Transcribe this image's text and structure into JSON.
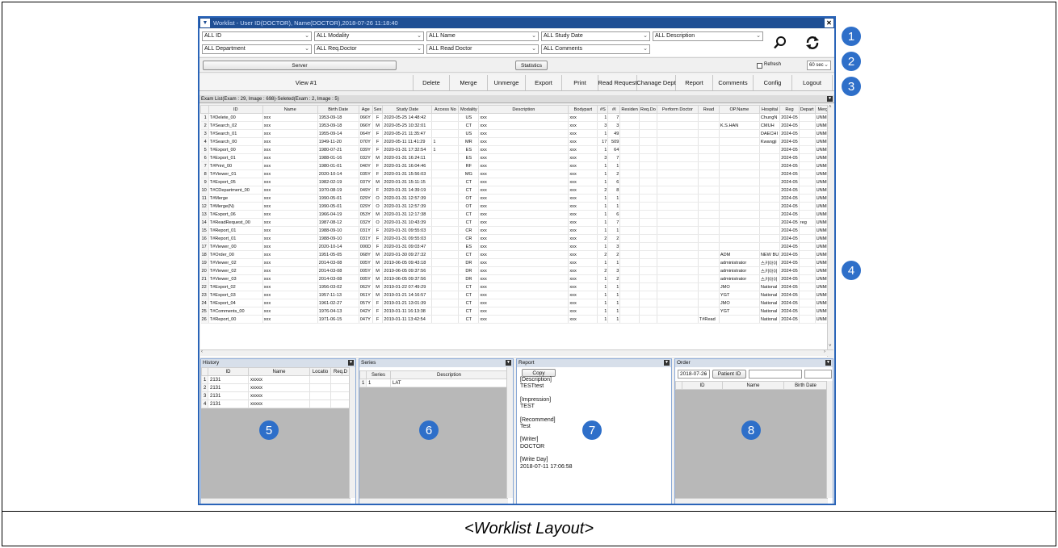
{
  "window": {
    "title": "Worklist - User ID(DOCTOR), Name(DOCTOR),2018-07-26 11:18:40"
  },
  "filters": {
    "row1": [
      "ALL ID",
      "ALL Modality",
      "ALL Name",
      "ALL Study Date",
      "ALL Description"
    ],
    "row2": [
      "ALL Department",
      "ALL Req.Doctor",
      "ALL Read Doctor",
      "ALL Comments"
    ],
    "search_icon": "search-icon",
    "refresh_icon": "refresh-icon"
  },
  "serverbar": {
    "server_label": "Server",
    "statistics_label": "Statistics",
    "refresh_label": "Refresh",
    "interval": "60 sec"
  },
  "toolbar": {
    "view": "View #1",
    "delete": "Delete",
    "merge": "Merge",
    "unmerge": "Unmerge",
    "export": "Export",
    "print": "Print",
    "read_request": "Read Request",
    "change_dept": "Chanage Dept",
    "report": "Report",
    "comments": "Comments",
    "config": "Config",
    "logout": "Logout"
  },
  "exam_list": {
    "header": "Exam List(Exam : 29, Image : 698)-Seleted(Exam : 2, Image : 5)",
    "columns": [
      "",
      "ID",
      "Name",
      "Birth Date",
      "Age",
      "Sex",
      "Study Date",
      "Access No",
      "Modality",
      "Description",
      "Bodypart",
      "#S",
      "#I",
      "Residen",
      "Req.Do",
      "Perform Doctor",
      "Read",
      "OP.Name",
      "Hospital",
      "Reg",
      "Depart",
      "Merg"
    ],
    "rows": [
      [
        "1",
        "T#Delete_00",
        "xxx",
        "1953-09-18",
        "066Y",
        "F",
        "2020-05-25 14:48:42",
        "",
        "US",
        "xxx",
        "xxx",
        "1",
        "7",
        "",
        "",
        "",
        "",
        "",
        "ChungN",
        "2024-05",
        "",
        "UNME"
      ],
      [
        "2",
        "T#Search_02",
        "xxx",
        "1953-09-18",
        "066Y",
        "M",
        "2020-05-25 10:32:01",
        "",
        "CT",
        "xxx",
        "xxx",
        "3",
        "3",
        "",
        "",
        "",
        "",
        "K.S.HAN",
        "CMUH",
        "2024-05",
        "",
        "UNME"
      ],
      [
        "3",
        "T#Search_01",
        "xxx",
        "1955-09-14",
        "064Y",
        "F",
        "2020-05-21 11:35:47",
        "",
        "US",
        "xxx",
        "xxx",
        "1",
        "49",
        "",
        "",
        "",
        "",
        "",
        "DAECHI",
        "2024-05",
        "",
        "UNME"
      ],
      [
        "4",
        "T#Search_00",
        "xxx",
        "1949-11-20",
        "070Y",
        "F",
        "2020-05-11 11:41:29",
        "1",
        "MR",
        "xxx",
        "xxx",
        "17",
        "509",
        "",
        "",
        "",
        "",
        "",
        "Kwangji",
        "2024-05",
        "",
        "UNME"
      ],
      [
        "5",
        "T#Export_00",
        "xxx",
        "1980-07-21",
        "039Y",
        "F",
        "2020-01-31 17:32:54",
        "1",
        "ES",
        "xxx",
        "xxx",
        "1",
        "64",
        "",
        "",
        "",
        "",
        "",
        "",
        "2024-05",
        "",
        "UNME"
      ],
      [
        "6",
        "T#Export_01",
        "xxx",
        "1988-01-16",
        "032Y",
        "M",
        "2020-01-31 16:24:11",
        "",
        "ES",
        "xxx",
        "xxx",
        "3",
        "7",
        "",
        "",
        "",
        "",
        "",
        "",
        "2024-05",
        "",
        "UNME"
      ],
      [
        "7",
        "T#Print_00",
        "xxx",
        "1980-01-01",
        "040Y",
        "F",
        "2020-01-31 16:04:46",
        "",
        "RF",
        "xxx",
        "xxx",
        "1",
        "1",
        "",
        "",
        "",
        "",
        "",
        "",
        "2024-05",
        "",
        "UNME"
      ],
      [
        "8",
        "T#Viewer_01",
        "xxx",
        "2020-10-14",
        "035Y",
        "F",
        "2020-01-31 15:56:03",
        "",
        "MG",
        "xxx",
        "xxx",
        "1",
        "2",
        "",
        "",
        "",
        "",
        "",
        "",
        "2024-05",
        "",
        "UNME"
      ],
      [
        "9",
        "T#Export_05",
        "xxx",
        "1982-02-19",
        "037Y",
        "M",
        "2020-01-31 15:11:15",
        "",
        "CT",
        "xxx",
        "xxx",
        "1",
        "6",
        "",
        "",
        "",
        "",
        "",
        "",
        "2024-05",
        "",
        "UNME"
      ],
      [
        "10",
        "T#CDepartment_00",
        "xxx",
        "1970-08-19",
        "049Y",
        "F",
        "2020-01-31 14:39:19",
        "",
        "CT",
        "xxx",
        "xxx",
        "2",
        "8",
        "",
        "",
        "",
        "",
        "",
        "",
        "2024-05",
        "",
        "UNME"
      ],
      [
        "11",
        "T#Merge",
        "xxx",
        "1990-05-01",
        "029Y",
        "O",
        "2020-01-31 12:57:39",
        "",
        "OT",
        "xxx",
        "xxx",
        "1",
        "1",
        "",
        "",
        "",
        "",
        "",
        "",
        "2024-05",
        "",
        "UNME"
      ],
      [
        "12",
        "T#Merge(N)",
        "xxx",
        "1990-05-01",
        "029Y",
        "O",
        "2020-01-31 12:57:39",
        "",
        "OT",
        "xxx",
        "xxx",
        "1",
        "1",
        "",
        "",
        "",
        "",
        "",
        "",
        "2024-05",
        "",
        "UNME"
      ],
      [
        "13",
        "T#Export_06",
        "xxx",
        "1966-04-19",
        "053Y",
        "M",
        "2020-01-31 12:17:38",
        "",
        "CT",
        "xxx",
        "xxx",
        "1",
        "6",
        "",
        "",
        "",
        "",
        "",
        "",
        "2024-05",
        "",
        "UNME"
      ],
      [
        "14",
        "T#ReadRequest_00",
        "xxx",
        "1987-08-12",
        "032Y",
        "O",
        "2020-01-31 10:43:39",
        "",
        "CT",
        "xxx",
        "xxx",
        "1",
        "7",
        "",
        "",
        "",
        "",
        "",
        "",
        "2024-05",
        "reg",
        "UNME"
      ],
      [
        "15",
        "T#Report_01",
        "xxx",
        "1988-09-10",
        "031Y",
        "F",
        "2020-01-31 09:55:03",
        "",
        "CR",
        "xxx",
        "xxx",
        "1",
        "1",
        "",
        "",
        "",
        "",
        "",
        "",
        "2024-05",
        "",
        "UNME"
      ],
      [
        "16",
        "T#Report_01",
        "xxx",
        "1988-09-10",
        "031Y",
        "F",
        "2020-01-31 09:55:03",
        "",
        "CR",
        "xxx",
        "xxx",
        "2",
        "2",
        "",
        "",
        "",
        "",
        "",
        "",
        "2024-05",
        "",
        "UNME"
      ],
      [
        "17",
        "T#Viewer_00",
        "xxx",
        "2020-10-14",
        "000D",
        "F",
        "2020-01-31 09:03:47",
        "",
        "ES",
        "xxx",
        "xxx",
        "1",
        "3",
        "",
        "",
        "",
        "",
        "",
        "",
        "2024-05",
        "",
        "UNME"
      ],
      [
        "18",
        "T#Order_00",
        "xxx",
        "1951-05-05",
        "068Y",
        "M",
        "2020-01-30 09:27:32",
        "",
        "CT",
        "xxx",
        "xxx",
        "2",
        "2",
        "",
        "",
        "",
        "",
        "ADM",
        "NEW BU",
        "2024-05",
        "",
        "UNME"
      ],
      [
        "19",
        "T#Viewer_02",
        "xxx",
        "2014-03-08",
        "005Y",
        "M",
        "2019-06-05 09:43:18",
        "",
        "DR",
        "xxx",
        "xxx",
        "1",
        "1",
        "",
        "",
        "",
        "",
        "administrator",
        "스키아이",
        "2024-05",
        "",
        "UNME"
      ],
      [
        "20",
        "T#Viewer_02",
        "xxx",
        "2014-03-08",
        "005Y",
        "M",
        "2019-06-05 09:37:56",
        "",
        "DR",
        "xxx",
        "xxx",
        "2",
        "3",
        "",
        "",
        "",
        "",
        "administrator",
        "스키아이",
        "2024-05",
        "",
        "UNME"
      ],
      [
        "21",
        "T#Viewer_03",
        "xxx",
        "2014-03-08",
        "005Y",
        "M",
        "2019-06-05 09:37:56",
        "",
        "DR",
        "xxx",
        "xxx",
        "1",
        "2",
        "",
        "",
        "",
        "",
        "administrator",
        "스키아이",
        "2024-05",
        "",
        "UNME"
      ],
      [
        "22",
        "T#Export_02",
        "xxx",
        "1956-03-02",
        "062Y",
        "M",
        "2019-01-22 07:49:29",
        "",
        "CT",
        "xxx",
        "xxx",
        "1",
        "1",
        "",
        "",
        "",
        "",
        "JMO",
        "National",
        "2024-05",
        "",
        "UNME"
      ],
      [
        "23",
        "T#Export_03",
        "xxx",
        "1957-11-13",
        "061Y",
        "M",
        "2019-01-21 14:16:57",
        "",
        "CT",
        "xxx",
        "xxx",
        "1",
        "1",
        "",
        "",
        "",
        "",
        "YGT",
        "National",
        "2024-05",
        "",
        "UNME"
      ],
      [
        "24",
        "T#Export_04",
        "xxx",
        "1961-02-27",
        "057Y",
        "F",
        "2019-01-21 13:01:39",
        "",
        "CT",
        "xxx",
        "xxx",
        "1",
        "1",
        "",
        "",
        "",
        "",
        "JMO",
        "National",
        "2024-05",
        "",
        "UNME"
      ],
      [
        "25",
        "T#Comments_00",
        "xxx",
        "1976-04-13",
        "042Y",
        "F",
        "2019-01-11 16:13:38",
        "",
        "CT",
        "xxx",
        "xxx",
        "1",
        "1",
        "",
        "",
        "",
        "",
        "YGT",
        "National",
        "2024-05",
        "",
        "UNME"
      ],
      [
        "26",
        "T#Report_00",
        "xxx",
        "1971-06-15",
        "047Y",
        "F",
        "2019-01-11 13:42:54",
        "",
        "CT",
        "xxx",
        "xxx",
        "1",
        "1",
        "",
        "",
        "",
        "T#Read",
        "",
        "National",
        "2024-05",
        "",
        "UNME"
      ]
    ]
  },
  "history": {
    "title": "History",
    "columns": [
      "",
      "ID",
      "Name",
      "Locatio",
      "Req.D"
    ],
    "rows": [
      [
        "1",
        "2131",
        "xxxxx",
        "",
        ""
      ],
      [
        "2",
        "2131",
        "xxxxx",
        "",
        ""
      ],
      [
        "3",
        "2131",
        "xxxxx",
        "",
        ""
      ],
      [
        "4",
        "2131",
        "xxxxx",
        "",
        ""
      ]
    ]
  },
  "series": {
    "title": "Series",
    "columns": [
      "",
      "Series",
      "Description"
    ],
    "rows": [
      [
        "1",
        "1",
        "LAT"
      ]
    ]
  },
  "report": {
    "title": "Report",
    "copy_label": "Copy",
    "description_label": "[Description]",
    "description": "TESTtest",
    "impression_label": "[Impression]",
    "impression": "TEST",
    "recommend_label": "[Recommend]",
    "recommend": "Test",
    "writer_label": "[Writer]",
    "writer": "DOCTOR",
    "write_day_label": "[Write Day]",
    "write_day": "2018-07-11 17:06:58"
  },
  "order": {
    "title": "Order",
    "date": "2018-07-26",
    "patient_id_label": "Patient ID",
    "columns": [
      "",
      "ID",
      "Name",
      "Birth Date"
    ]
  },
  "callouts": [
    "1",
    "2",
    "3",
    "4",
    "5",
    "6",
    "7",
    "8"
  ],
  "caption": "<Worklist Layout>",
  "colors": {
    "title_bar": "#1f4f94",
    "callout": "#2e6fc9",
    "pane_border": "#8aa9d6"
  }
}
